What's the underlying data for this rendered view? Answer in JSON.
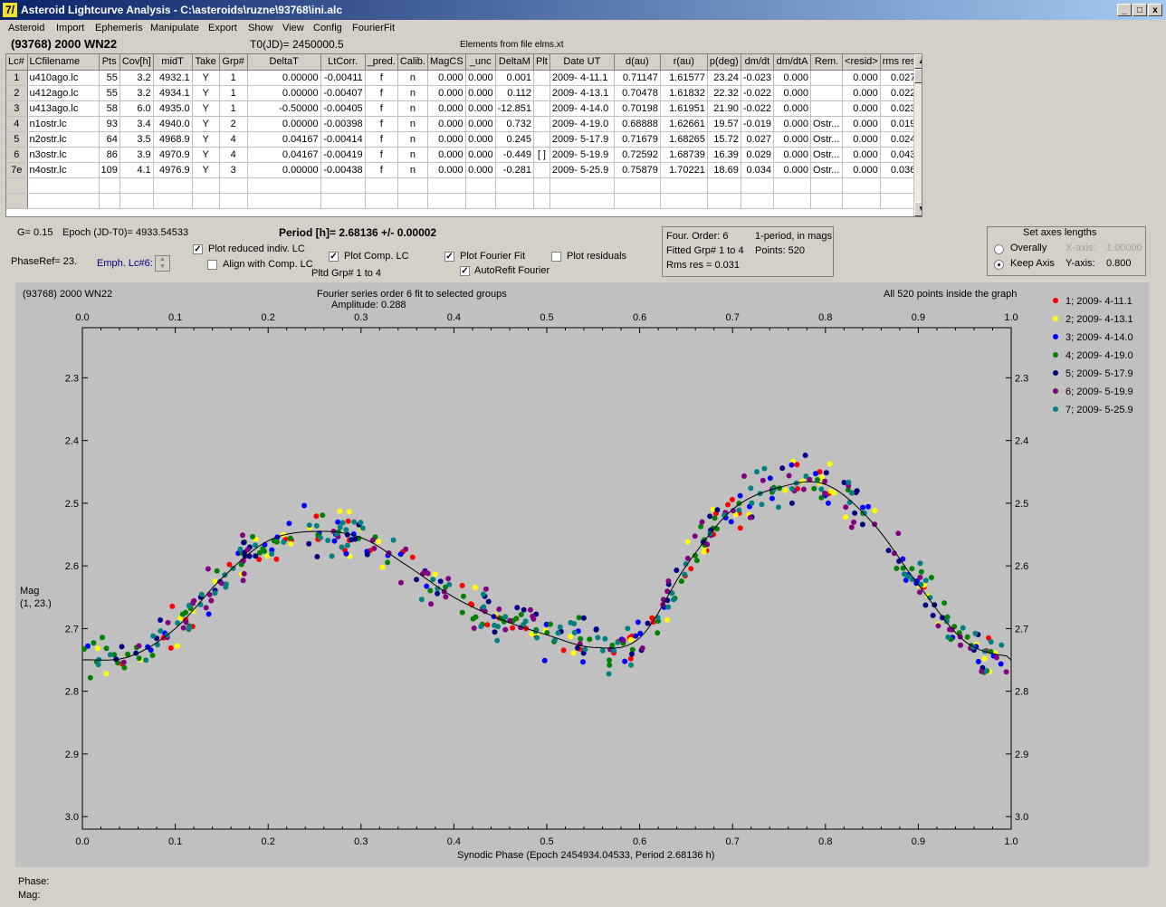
{
  "window": {
    "title": "Asteroid Lightcurve Analysis - C:\\asteroids\\ruzne\\93768\\ini.alc",
    "app_icon": "7/",
    "minimize": "_",
    "maximize": "□",
    "close": "x"
  },
  "menu": [
    "Asteroid",
    "Import",
    "Ephemeris",
    "Manipulate",
    "Export",
    "Show",
    "View",
    "Config",
    "FourierFit"
  ],
  "header": {
    "object": "(93768) 2000 WN22",
    "t0": "T0(JD)= 2450000.5",
    "elements": "Elements from file elms.xt"
  },
  "table": {
    "columns": [
      "Lc#",
      "LCfilename",
      "Pts",
      "Cov[h]",
      "midT",
      "Take",
      "Grp#",
      "DeltaT",
      "LtCorr.",
      "_pred.",
      "Calib.",
      "MagCS",
      "_unc",
      "DeltaM",
      "Plt",
      "Date UT",
      "d(au)",
      "r(au)",
      "p(deg)",
      "dm/dt",
      "dm/dtA",
      "Rem.",
      "<resid>",
      "rms res"
    ],
    "rows": [
      [
        "1",
        "u410ago.lc",
        "55",
        "3.2",
        "4932.1",
        "Y",
        "1",
        "0.00000",
        "-0.00411",
        "f",
        "n",
        "0.000",
        "0.000",
        "0.001",
        "",
        "2009- 4-11.1",
        "0.71147",
        "1.61577",
        "23.24",
        "-0.023",
        "0.000",
        "",
        "0.000",
        "0.027"
      ],
      [
        "2",
        "u412ago.lc",
        "55",
        "3.2",
        "4934.1",
        "Y",
        "1",
        "0.00000",
        "-0.00407",
        "f",
        "n",
        "0.000",
        "0.000",
        "0.112",
        "",
        "2009- 4-13.1",
        "0.70478",
        "1.61832",
        "22.32",
        "-0.022",
        "0.000",
        "",
        "0.000",
        "0.022"
      ],
      [
        "3",
        "u413ago.lc",
        "58",
        "6.0",
        "4935.0",
        "Y",
        "1",
        "-0.50000",
        "-0.00405",
        "f",
        "n",
        "0.000",
        "0.000",
        "-12.851",
        "",
        "2009- 4-14.0",
        "0.70198",
        "1.61951",
        "21.90",
        "-0.022",
        "0.000",
        "",
        "0.000",
        "0.023"
      ],
      [
        "4",
        "n1ostr.lc",
        "93",
        "3.4",
        "4940.0",
        "Y",
        "2",
        "0.00000",
        "-0.00398",
        "f",
        "n",
        "0.000",
        "0.000",
        "0.732",
        "",
        "2009- 4-19.0",
        "0.68888",
        "1.62661",
        "19.57",
        "-0.019",
        "0.000",
        "Ostr...",
        "0.000",
        "0.019"
      ],
      [
        "5",
        "n2ostr.lc",
        "64",
        "3.5",
        "4968.9",
        "Y",
        "4",
        "0.04167",
        "-0.00414",
        "f",
        "n",
        "0.000",
        "0.000",
        "0.245",
        "",
        "2009- 5-17.9",
        "0.71679",
        "1.68265",
        "15.72",
        "0.027",
        "0.000",
        "Ostr...",
        "0.000",
        "0.024"
      ],
      [
        "6",
        "n3ostr.lc",
        "86",
        "3.9",
        "4970.9",
        "Y",
        "4",
        "0.04167",
        "-0.00419",
        "f",
        "n",
        "0.000",
        "0.000",
        "-0.449",
        "[ ]",
        "2009- 5-19.9",
        "0.72592",
        "1.68739",
        "16.39",
        "0.029",
        "0.000",
        "Ostr...",
        "0.000",
        "0.043"
      ],
      [
        "7e",
        "n4ostr.lc",
        "109",
        "4.1",
        "4976.9",
        "Y",
        "3",
        "0.00000",
        "-0.00438",
        "f",
        "n",
        "0.000",
        "0.000",
        "-0.281",
        "",
        "2009- 5-25.9",
        "0.75879",
        "1.70221",
        "18.69",
        "0.034",
        "0.000",
        "Ostr...",
        "0.000",
        "0.036"
      ]
    ]
  },
  "controls": {
    "g": "G= 0.15",
    "epoch": "Epoch (JD-T0)= 4933.54533",
    "period": "Period [h]= 2.68136 +/- 0.00002",
    "phaseref": "PhaseRef= 23.",
    "emph": "Emph. Lc#6:",
    "plot_reduced": "Plot reduced indiv. LC",
    "align_comp": "Align with Comp. LC",
    "plot_comp": "Plot Comp. LC",
    "plotted_grp": "Pltd Grp#  1   to   4",
    "plot_fourier": "Plot Fourier Fit",
    "autorefit": "AutoRefit Fourier",
    "plot_residuals": "Plot residuals",
    "four_order": "Four. Order:  6",
    "one_period": "1-period, in mags",
    "fitted": "Fitted Grp# 1 to 4",
    "points": "Points: 520",
    "rms": "Rms res     = 0.031",
    "axes_title": "Set axes lengths",
    "overally": "Overally",
    "keep_axis": "Keep Axis",
    "xaxis_label": "X-axis:",
    "xaxis_val": "1.00000",
    "yaxis_label": "Y-axis:",
    "yaxis_val": "0.800"
  },
  "plot": {
    "name_label": "(93768) 2000 WN22",
    "fourier_label": "Fourier series order 6 fit to selected groups",
    "amplitude": "Amplitude: 0.288",
    "points_inside": "All 520 points inside the graph",
    "ylabel": "Mag",
    "ylabel2": "(1, 23.)",
    "xlabel": "Synodic Phase (Epoch 2454934.04533, Period 2.68136 h)",
    "status_phase": "Phase:",
    "status_mag": "Mag:"
  },
  "chart_data": {
    "type": "scatter",
    "x_ticks": [
      "0.0",
      "0.1",
      "0.2",
      "0.3",
      "0.4",
      "0.5",
      "0.6",
      "0.7",
      "0.8",
      "0.9",
      "1.0"
    ],
    "y_ticks": [
      "2.3",
      "2.4",
      "2.5",
      "2.6",
      "2.7",
      "2.8",
      "2.9",
      "3.0"
    ],
    "xlim": [
      0,
      1
    ],
    "ylim": [
      3.02,
      2.22
    ],
    "series": [
      {
        "name": "1; 2009- 4-11.1",
        "color": "#ff0000"
      },
      {
        "name": "2; 2009- 4-13.1",
        "color": "#ffff00"
      },
      {
        "name": "3; 2009- 4-14.0",
        "color": "#0000ff"
      },
      {
        "name": "4; 2009- 4-19.0",
        "color": "#008000"
      },
      {
        "name": "5; 2009- 5-17.9",
        "color": "#000080"
      },
      {
        "name": "6; 2009- 5-19.9",
        "color": "#800080"
      },
      {
        "name": "7; 2009- 5-25.9",
        "color": "#008080"
      }
    ],
    "fit": {
      "x": [
        0.0,
        0.05,
        0.1,
        0.15,
        0.2,
        0.25,
        0.3,
        0.35,
        0.4,
        0.45,
        0.5,
        0.55,
        0.6,
        0.65,
        0.7,
        0.75,
        0.8,
        0.85,
        0.9,
        0.95,
        1.0
      ],
      "y": [
        2.75,
        2.745,
        2.7,
        2.62,
        2.56,
        2.545,
        2.555,
        2.6,
        2.65,
        2.685,
        2.71,
        2.73,
        2.715,
        2.6,
        2.51,
        2.475,
        2.47,
        2.53,
        2.63,
        2.72,
        2.745
      ]
    }
  }
}
